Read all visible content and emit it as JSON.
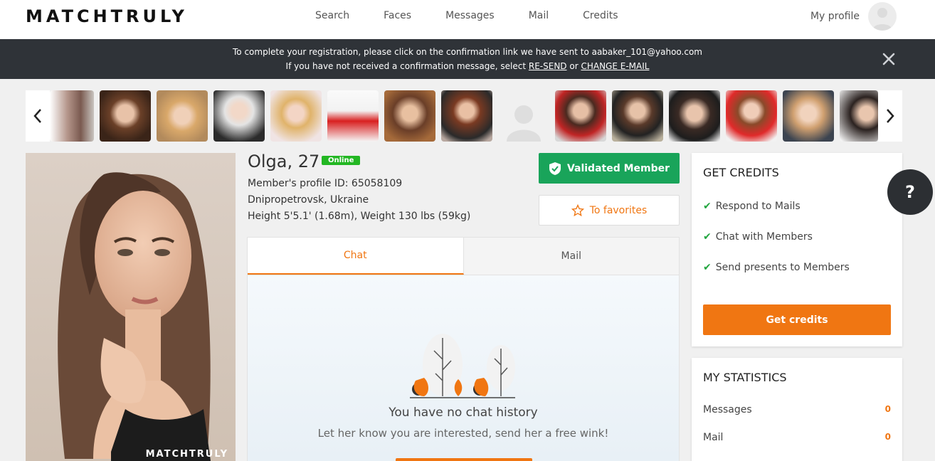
{
  "header": {
    "logo": "MATCHTRULY",
    "nav": [
      "Search",
      "Faces",
      "Messages",
      "Mail",
      "Credits"
    ],
    "my_profile": "My profile"
  },
  "banner": {
    "line1": "To complete your registration, please click on the confirmation link we have sent to aabaker_101@yahoo.com",
    "line2_prefix": "If you have not received a confirmation message, select ",
    "resend": "RE-SEND",
    "or": " or ",
    "change_email": "CHANGE E-MAIL"
  },
  "profile": {
    "name_age": "Olga, 27",
    "status": "Online",
    "profile_id": "Member's profile ID: 65058109",
    "location": "Dnipropetrovsk, Ukraine",
    "body": "Height 5'5.1' (1.68m), Weight 130 lbs (59kg)",
    "validated": "Validated Member",
    "favorites": "To favorites",
    "watermark": "MATCHTRULY"
  },
  "tabs": {
    "chat": "Chat",
    "mail": "Mail"
  },
  "chat": {
    "empty_title": "You have no chat history",
    "empty_sub": "Let her know you are interested, send her a free wink!"
  },
  "credits_card": {
    "title": "GET CREDITS",
    "features": [
      "Respond to Mails",
      "Chat with Members",
      "Send presents to Members"
    ],
    "button": "Get credits"
  },
  "stats_card": {
    "title": "MY STATISTICS",
    "rows": [
      {
        "label": "Messages",
        "value": "0"
      },
      {
        "label": "Mail",
        "value": "0"
      }
    ]
  },
  "help_label": "?",
  "colors": {
    "accent": "#f07612",
    "validated": "#19a45a",
    "online": "#23b723",
    "banner_bg": "#2f3338"
  }
}
